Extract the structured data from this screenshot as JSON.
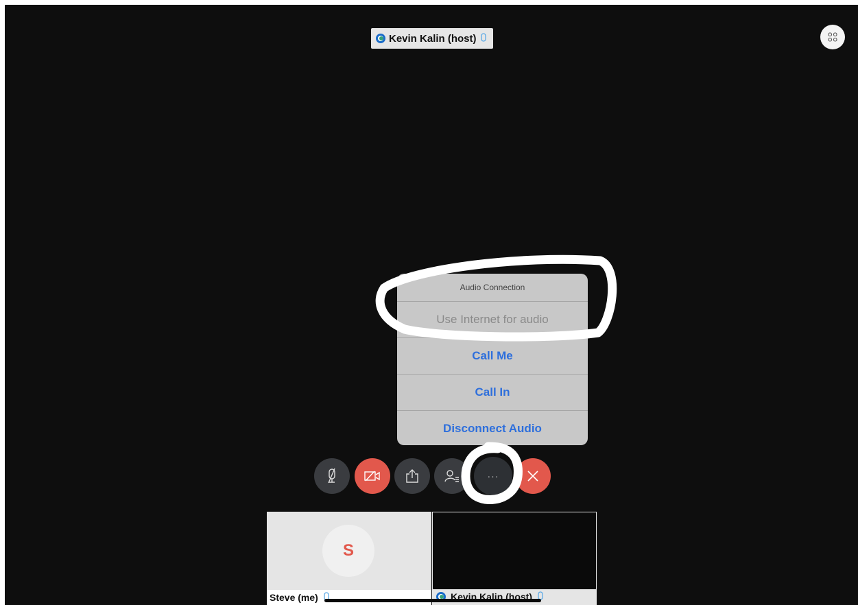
{
  "active_speaker": {
    "name": "Kevin Kalin (host)"
  },
  "audio_menu": {
    "title": "Audio Connection",
    "items": [
      {
        "label": "Use Internet for audio",
        "enabled": false
      },
      {
        "label": "Call Me",
        "enabled": true
      },
      {
        "label": "Call In",
        "enabled": true
      },
      {
        "label": "Disconnect Audio",
        "enabled": true
      }
    ]
  },
  "toolbar": {
    "more_label": "···"
  },
  "participants": [
    {
      "name": "Steve (me)",
      "avatar_initial": "S"
    },
    {
      "name": "Kevin Kalin (host)"
    }
  ],
  "colors": {
    "accent_blue": "#2e6fdc",
    "end_red": "#e2584c",
    "mic_blue": "#5aa9e6"
  }
}
